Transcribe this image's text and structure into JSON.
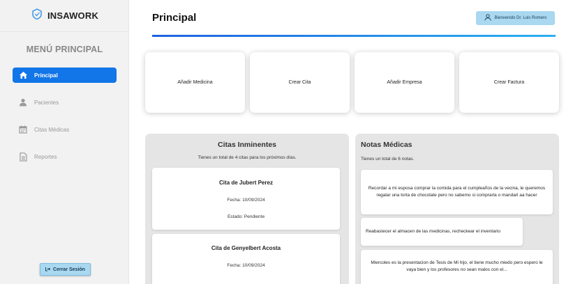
{
  "app": {
    "logo_text": "INSAWORK"
  },
  "sidebar": {
    "menu_title": "MENÚ PRINCIPAL",
    "items": [
      {
        "label": "Principal",
        "icon": "home-icon",
        "active": true
      },
      {
        "label": "Pacientes",
        "icon": "user-icon",
        "active": false
      },
      {
        "label": "Citas Médicas",
        "icon": "calendar-icon",
        "active": false
      },
      {
        "label": "Reportes",
        "icon": "document-icon",
        "active": false
      }
    ],
    "logout_label": "Cerrar Sesión"
  },
  "header": {
    "title": "Principal",
    "welcome": "Bienvenido Dr. Luis Romero"
  },
  "actions": [
    {
      "label": "Añadir Medicina"
    },
    {
      "label": "Crear Cita"
    },
    {
      "label": "Añadir Empresa"
    },
    {
      "label": "Crear Factura"
    }
  ],
  "citas": {
    "title": "Citas Inminentes",
    "subtitle": "Tienes un total de 4 citas para los próximos días.",
    "items": [
      {
        "name": "Cita de Jubert Perez",
        "fecha": "Fecha: 10/09/2024",
        "estado": "Estado: Pendiente"
      },
      {
        "name": "Cita de Genyelbert Acosta",
        "fecha": "Fecha: 10/09/2024"
      }
    ]
  },
  "notas": {
    "title": "Notas Médicas",
    "subtitle": "Tienes un total de 6 notas.",
    "items": [
      {
        "text": "Recordar a mi esposa comprar la comida para el cumpleaños de la vecina, le queremos regalar una torta de chocolate pero no sabemo si comprarla o mandarl aa hacer"
      },
      {
        "text": "Reabastecer el almacen de las medicinas, recheckear el inventario"
      },
      {
        "text": "Miercoles es la presentacion de Tesis de Mi hijo, el tiene mucho miedo pero espero le vaya bien y los profesores no sean malos con el..."
      }
    ]
  },
  "colors": {
    "accent": "#1275e8",
    "welcome_bg": "#a9d8f0",
    "sidebar_bg": "#f2f2f2",
    "panel_bg": "#e5e5e5"
  }
}
